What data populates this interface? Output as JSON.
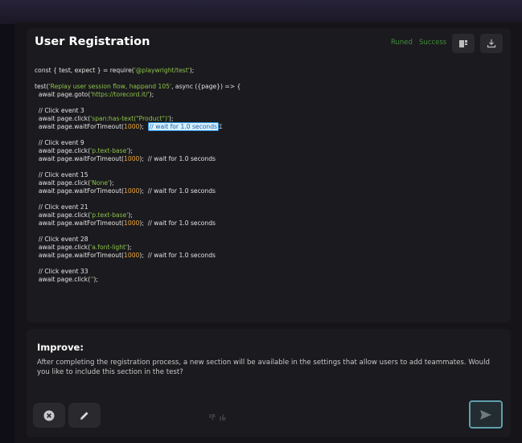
{
  "panel": {
    "title": "User Registration",
    "status_runed": "Runed",
    "status_success": "Success",
    "copy_icon": "clipboard-icon",
    "download_icon": "download-icon"
  },
  "code": {
    "l1a": "const { test, expect } = require(",
    "l1b": "'@playwright/test'",
    "l1c": ");",
    "l2a": "test(",
    "l2b": "'Replay user session flow, happand 105'",
    "l2c": ", async ({page}) => {",
    "l3a": "  await page.goto(",
    "l3b": "'https://torecord.it/'",
    "l3c": ");",
    "c1": "  // Click event 3",
    "c1_click_a": "  await page.click(",
    "c1_click_b": "'span:has-text(\"Product\")'",
    "c1_click_c": ");",
    "c2": "  // Click event 9",
    "c2_click_b": "'p.text-base'",
    "c3": "  // Click event 15",
    "c3_click_b": "'None'",
    "c4": "  // Click event 21",
    "c4_click_b": "'p.text-base'",
    "c5": "  // Click event 28",
    "c5_click_b": "'a.font-light'",
    "c6": "  // Click event 33",
    "c6_click_b": "''",
    "wait_a": "  await page.waitForTimeout(",
    "wait_num": "1000",
    "wait_c": ");  ",
    "wait_comment": "// wait for 1.0 seconds"
  },
  "improve": {
    "title": "Improve:",
    "text": "After completing the registration process, a new section will be available in the settings that allow users to add teammates. Would you like to include this section in the test?"
  },
  "actions": {
    "close_icon": "close-circle-icon",
    "edit_icon": "pencil-icon",
    "send_icon": "send-icon",
    "thumbs_down_icon": "thumbs-down-icon",
    "thumbs_up_icon": "thumbs-up-icon"
  },
  "colors": {
    "string": "#8bc34a",
    "number": "#f0a83a",
    "status_green": "#3f8f3a",
    "highlight_bg": "#d8f1ff",
    "send_border": "#5f9fac"
  }
}
